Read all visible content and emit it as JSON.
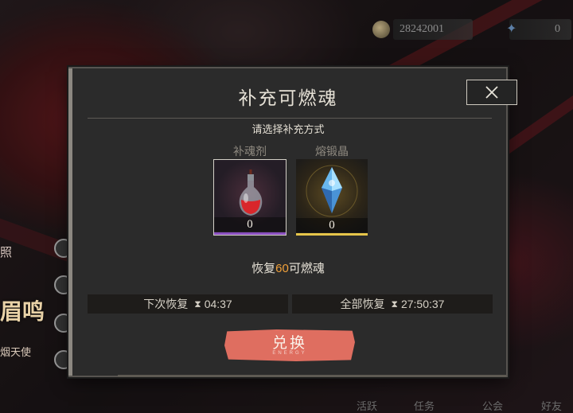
{
  "topbar": {
    "currency_value": "28242001",
    "second_currency_value": "0"
  },
  "background": {
    "side_label_1": "照",
    "side_label_2": "眉鸣",
    "side_label_3": "烟天使",
    "bottom_tabs": [
      "活跃",
      "任务",
      "公会",
      "好友"
    ]
  },
  "dialog": {
    "title": "补充可燃魂",
    "subtitle": "请选择补充方式",
    "options": [
      {
        "label": "补魂剂",
        "count": "0",
        "icon": "potion-icon",
        "selected": true,
        "accent": "#8a4fc0"
      },
      {
        "label": "熔锻晶",
        "count": "0",
        "icon": "crystal-icon",
        "selected": false,
        "accent": "#e6c54a"
      }
    ],
    "restore": {
      "prefix": "恢复",
      "amount": "60",
      "suffix": "可燃魂",
      "amount_color": "#f0a03a"
    },
    "next_restore": {
      "label": "下次恢复",
      "time": "04:37"
    },
    "full_restore": {
      "label": "全部恢复",
      "time": "27:50:37"
    },
    "exchange_button": {
      "label": "兑换",
      "sub_label": "ENERGY"
    },
    "close_icon": "close-icon"
  }
}
